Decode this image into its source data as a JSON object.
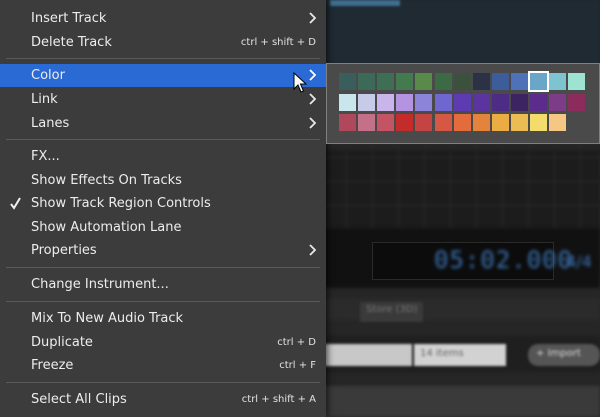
{
  "background": {
    "time_display": "05:02.000",
    "time_right": "4/4",
    "tabs": [
      "Store (3D)"
    ],
    "items_count": "14 items",
    "import_button": "+ Import"
  },
  "menu": {
    "items": [
      {
        "label": "Insert Track",
        "shortcut": "",
        "submenu": true
      },
      {
        "label": "Delete Track",
        "shortcut": "ctrl + shift + D",
        "submenu": false
      },
      {
        "label": "Color",
        "shortcut": "",
        "submenu": true,
        "highlighted": true
      },
      {
        "label": "Link",
        "shortcut": "",
        "submenu": true
      },
      {
        "label": "Lanes",
        "shortcut": "",
        "submenu": true
      },
      {
        "label": "FX...",
        "shortcut": "",
        "submenu": false
      },
      {
        "label": "Show Effects On Tracks",
        "shortcut": "",
        "submenu": false
      },
      {
        "label": "Show Track Region Controls",
        "shortcut": "",
        "submenu": false,
        "checked": true
      },
      {
        "label": "Show Automation Lane",
        "shortcut": "",
        "submenu": false
      },
      {
        "label": "Properties",
        "shortcut": "",
        "submenu": true
      },
      {
        "label": "Change Instrument...",
        "shortcut": "",
        "submenu": false
      },
      {
        "label": "Mix To New Audio Track",
        "shortcut": "",
        "submenu": false
      },
      {
        "label": "Duplicate",
        "shortcut": "ctrl + D",
        "submenu": false
      },
      {
        "label": "Freeze",
        "shortcut": "ctrl + F",
        "submenu": false
      },
      {
        "label": "Select All Clips",
        "shortcut": "ctrl + shift + A",
        "submenu": false
      }
    ]
  },
  "palette": {
    "selected": "#6aa6c8",
    "rows": [
      [
        "#3a5e5c",
        "#3c6a58",
        "#3e6e54",
        "#447a50",
        "#5a8a4a",
        "#3c6a44",
        "#3c503e",
        "#2c3246",
        "#3c5c9a",
        "#4e72b8",
        "#6aa6c8",
        "#7ec4d0",
        "#9ee2d2"
      ],
      [
        "#c8e6ec",
        "#c6cce8",
        "#cab4ec",
        "#b494e0",
        "#8c84d8",
        "#7066d0",
        "#5c3cb0",
        "#5c34a0",
        "#4c2c84",
        "#3c2462",
        "#5c2c8c",
        "#7c3c88",
        "#8c2c5c"
      ],
      [
        "#b0485c",
        "#c47088",
        "#c45464",
        "#c42c2c",
        "#c44444",
        "#d45844",
        "#e46c3c",
        "#e4843c",
        "#ecac44",
        "#ecbc54",
        "#f4dc6c",
        "#f4c884"
      ]
    ]
  }
}
